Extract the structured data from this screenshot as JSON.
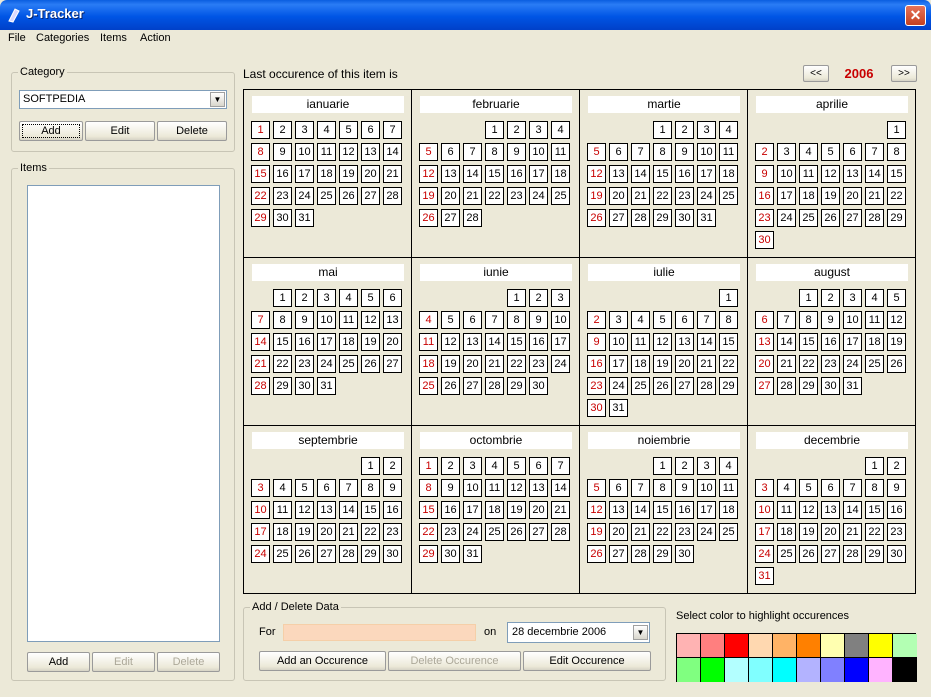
{
  "window": {
    "title": "J-Tracker"
  },
  "menu": [
    "File",
    "Categories",
    "Items",
    "Action"
  ],
  "category": {
    "legend": "Category",
    "selected": "SOFTPEDIA",
    "buttons": {
      "add": "Add",
      "edit": "Edit",
      "delete": "Delete"
    }
  },
  "items": {
    "legend": "Items",
    "buttons": {
      "add": "Add",
      "edit": "Edit",
      "delete": "Delete"
    }
  },
  "calendar": {
    "header": "Last occurence of this item is",
    "year": "2006",
    "prev": "<<",
    "next": ">>",
    "months": [
      {
        "name": "ianuarie",
        "offset": 0,
        "days": 31
      },
      {
        "name": "februarie",
        "offset": 3,
        "days": 28
      },
      {
        "name": "martie",
        "offset": 3,
        "days": 31
      },
      {
        "name": "aprilie",
        "offset": 6,
        "days": 30
      },
      {
        "name": "mai",
        "offset": 1,
        "days": 31
      },
      {
        "name": "iunie",
        "offset": 4,
        "days": 30
      },
      {
        "name": "iulie",
        "offset": 6,
        "days": 31
      },
      {
        "name": "august",
        "offset": 2,
        "days": 31
      },
      {
        "name": "septembrie",
        "offset": 5,
        "days": 30
      },
      {
        "name": "octombrie",
        "offset": 0,
        "days": 31
      },
      {
        "name": "noiembrie",
        "offset": 3,
        "days": 30
      },
      {
        "name": "decembrie",
        "offset": 5,
        "days": 31
      }
    ]
  },
  "add_delete": {
    "legend": "Add / Delete Data",
    "for_label": "For",
    "on_label": "on",
    "date": "28 decembrie 2006",
    "buttons": {
      "add": "Add an Occurence",
      "delete": "Delete Occurence",
      "edit": "Edit Occurence"
    }
  },
  "colors": {
    "label": "Select color to highlight occurences",
    "palette": [
      "#ffb3b3",
      "#ff7f7f",
      "#ff0000",
      "#ffd8b0",
      "#ffb366",
      "#ff8000",
      "#ffffb0",
      "#808080",
      "#ffff00",
      "#b3ffb3",
      "#80ff80",
      "#00ff00",
      "#b3ffff",
      "#80ffff",
      "#00ffff",
      "#b3b3ff",
      "#8080ff",
      "#0000ff",
      "#ffb3ff",
      "#000000"
    ]
  },
  "sunday_color": "#c80000"
}
